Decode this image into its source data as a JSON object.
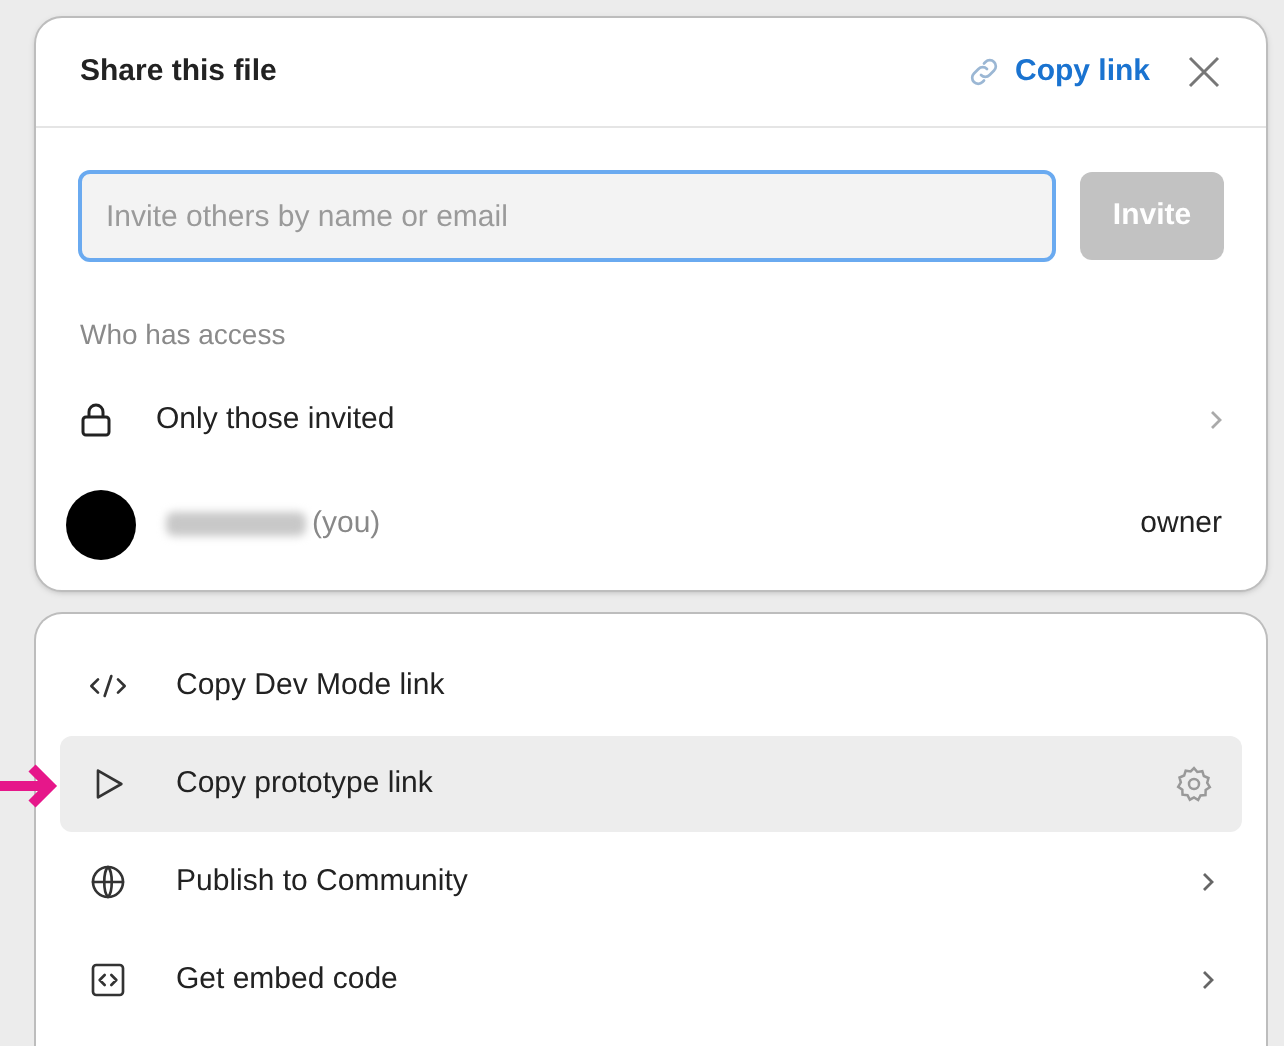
{
  "dialog": {
    "title": "Share this file",
    "copy_link": "Copy link"
  },
  "invite": {
    "placeholder": "Invite others by name or email",
    "button": "Invite",
    "button_disabled": true
  },
  "access": {
    "heading": "Who has access",
    "setting": "Only those invited",
    "people": [
      {
        "redacted": true,
        "suffix": "(you)",
        "role": "owner"
      }
    ]
  },
  "menu": [
    {
      "kind": "code",
      "label": "Copy Dev Mode link",
      "selected": false
    },
    {
      "kind": "play",
      "label": "Copy prototype link",
      "trailing": {
        "kind": "gear"
      },
      "selected": true
    },
    {
      "kind": "globe",
      "label": "Publish to Community",
      "trailing": {
        "kind": "chevron"
      },
      "selected": false
    },
    {
      "kind": "embed",
      "label": "Get embed code",
      "trailing": {
        "kind": "chevron"
      },
      "selected": false
    }
  ],
  "annotation": {
    "kind": "arrow",
    "color": "#e6178a"
  }
}
